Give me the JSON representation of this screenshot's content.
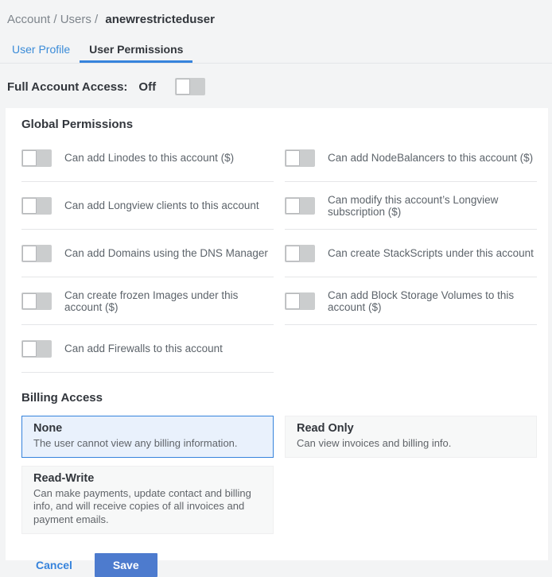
{
  "breadcrumb": {
    "prefix": "Account / Users /",
    "current": "anewrestricteduser"
  },
  "tabs": [
    {
      "label": "User Profile",
      "active": false
    },
    {
      "label": "User Permissions",
      "active": true
    }
  ],
  "full_account_access": {
    "label": "Full Account Access:",
    "value": "Off",
    "enabled": false
  },
  "global_permissions": {
    "title": "Global Permissions",
    "items": [
      {
        "label": "Can add Linodes to this account ($)",
        "enabled": false
      },
      {
        "label": "Can add NodeBalancers to this account ($)",
        "enabled": false
      },
      {
        "label": "Can add Longview clients to this account",
        "enabled": false
      },
      {
        "label": "Can modify this account’s Longview subscription ($)",
        "enabled": false
      },
      {
        "label": "Can add Domains using the DNS Manager",
        "enabled": false
      },
      {
        "label": "Can create StackScripts under this account",
        "enabled": false
      },
      {
        "label": "Can create frozen Images under this account ($)",
        "enabled": false
      },
      {
        "label": "Can add Block Storage Volumes to this account ($)",
        "enabled": false
      },
      {
        "label": "Can add Firewalls to this account",
        "enabled": false
      }
    ]
  },
  "billing_access": {
    "title": "Billing Access",
    "options": [
      {
        "title": "None",
        "description": "The user cannot view any billing information.",
        "selected": true
      },
      {
        "title": "Read Only",
        "description": "Can view invoices and billing info.",
        "selected": false
      },
      {
        "title": "Read-Write",
        "description": "Can make payments, update contact and billing info, and will receive copies of all invoices and payment emails.",
        "selected": false
      }
    ]
  },
  "actions": {
    "cancel_label": "Cancel",
    "save_label": "Save"
  },
  "colors": {
    "accent_blue": "#3683dc",
    "save_button_blue": "#4d7bce",
    "selected_card_bg": "#e9f1fc",
    "toggle_track": "#cbcdce",
    "page_bg": "#f3f4f5",
    "panel_bg": "#ffffff",
    "dark_text": "#32363c",
    "muted_text": "#5d646b"
  }
}
